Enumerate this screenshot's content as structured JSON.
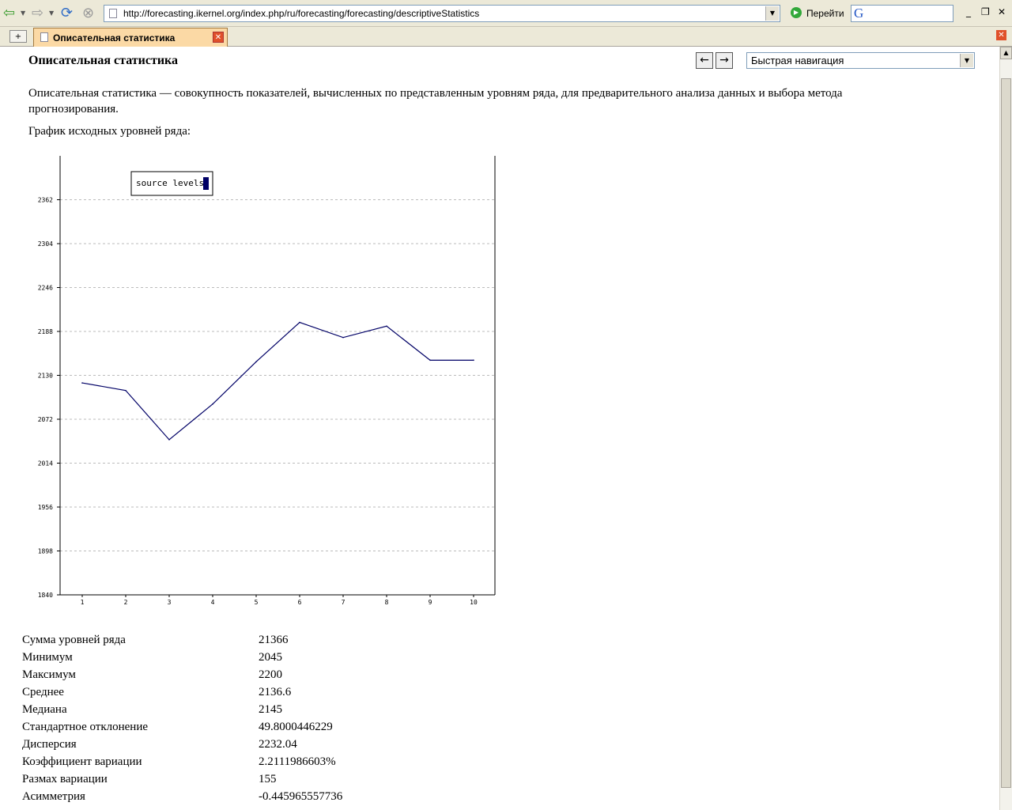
{
  "browser": {
    "url": "http://forecasting.ikernel.org/index.php/ru/forecasting/forecasting/descriptiveStatistics",
    "go_label": "Перейти",
    "search_logo": "G",
    "tab_title": "Описательная статистика"
  },
  "page": {
    "title": "Описательная статистика",
    "prev_arrow": "←",
    "next_arrow": "→",
    "quick_nav": "Быстрая навигация",
    "description": "Описательная статистика — совокупность показателей, вычисленных по представленным уровням ряда, для предварительного анализа данных и выбора метода прогнозирования.",
    "chart_caption": "График исходных уровней ряда:"
  },
  "chart_data": {
    "type": "line",
    "x": [
      1,
      2,
      3,
      4,
      5,
      6,
      7,
      8,
      9,
      10
    ],
    "series": [
      {
        "name": "source levels",
        "values": [
          2120,
          2110,
          2045,
          2092,
          2148,
          2200,
          2180,
          2195,
          2150,
          2150
        ],
        "color": "#000066"
      }
    ],
    "ylim": [
      1840,
      2420
    ],
    "yticks": [
      "1840",
      "1898",
      "1956",
      "2014",
      "2072",
      "2130",
      "2188",
      "2246",
      "2304",
      "2362"
    ],
    "xticks": [
      "1",
      "2",
      "3",
      "4",
      "5",
      "6",
      "7",
      "8",
      "9",
      "10"
    ],
    "grid": true,
    "legend": "top-left"
  },
  "stats": [
    {
      "label": "Сумма уровней ряда",
      "value": "21366"
    },
    {
      "label": "Минимум",
      "value": "2045"
    },
    {
      "label": "Максимум",
      "value": "2200"
    },
    {
      "label": "Среднее",
      "value": "2136.6"
    },
    {
      "label": "Медиана",
      "value": "2145"
    },
    {
      "label": "Стандартное отклонение",
      "value": "49.8000446229"
    },
    {
      "label": "Дисперсия",
      "value": "2232.04"
    },
    {
      "label": "Коэффициент вариации",
      "value": "2.2111986603%"
    },
    {
      "label": "Размах вариации",
      "value": "155"
    },
    {
      "label": "Асимметрия",
      "value": "-0.445965557736"
    }
  ]
}
